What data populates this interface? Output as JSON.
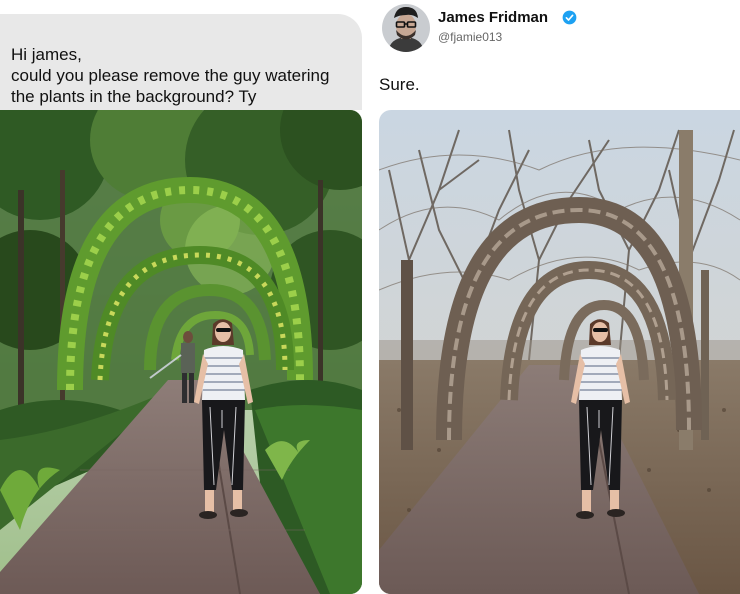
{
  "request": {
    "text": "Hi james,\n could you please remove the guy watering\nthe plants in the background? Ty"
  },
  "reply_tweet": {
    "author_name": "James Fridman",
    "author_handle": "@fjamie013",
    "text": "Sure."
  },
  "icons": {
    "verified": "verified-badge-icon"
  },
  "colors": {
    "bubble_bg": "#e8e8e8",
    "verified": "#1da1f2"
  }
}
